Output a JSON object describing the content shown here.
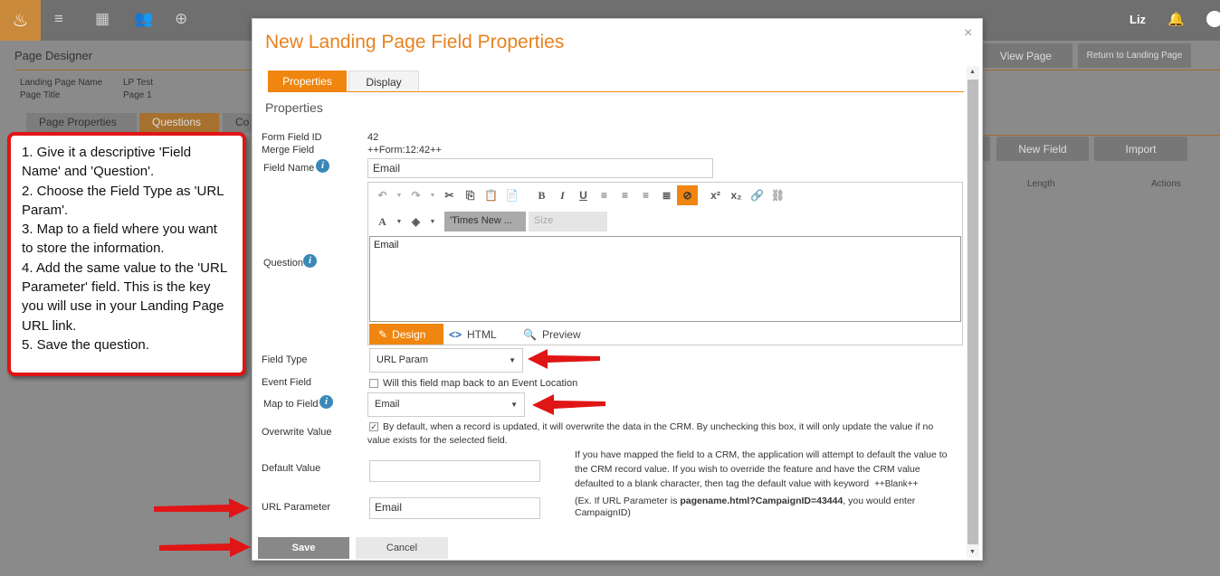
{
  "topbar": {
    "user": "Liz"
  },
  "background": {
    "title": "Page Designer",
    "meta_labels": [
      "Landing Page Name",
      "Page Title"
    ],
    "meta_values": [
      "LP Test",
      "Page 1"
    ],
    "tabs": [
      "Page Properties",
      "Questions",
      "Co"
    ],
    "view_page": "View Page",
    "return_btn": "Return to Landing Page",
    "new_field": "New Field",
    "import": "Import",
    "col_length": "Length",
    "col_actions": "Actions"
  },
  "modal": {
    "title": "New Landing Page Field Properties",
    "close": "×",
    "tabs": [
      "Properties",
      "Display"
    ],
    "section": "Properties",
    "form_field_id_label": "Form Field ID",
    "form_field_id": "42",
    "merge_field_label": "Merge Field",
    "merge_field": "++Form:12:42++",
    "field_name_label": "Field Name",
    "field_name": "Email",
    "question_label": "Question",
    "question_text": "Email",
    "font_name": "'Times New ...",
    "font_size": "Size",
    "modes": [
      "Design",
      "HTML",
      "Preview"
    ],
    "field_type_label": "Field Type",
    "field_type": "URL Param",
    "event_field_label": "Event Field",
    "event_field_text": "Will this field map back to an Event Location",
    "map_to_field_label": "Map to Field",
    "map_to_field": "Email",
    "overwrite_label": "Overwrite Value",
    "overwrite_text": "By default, when a record is updated, it will overwrite the data in the CRM. By unchecking this box, it will only update the value if no value exists for the selected field.",
    "default_value_label": "Default Value",
    "default_value": "",
    "default_help_1": "If you have mapped the field to a CRM, the application will attempt to default the value to the CRM record value.  If you wish to override the feature and have the CRM value defaulted to a blank character, then tag the default value with keyword",
    "default_help_keyword": "++Blank++",
    "url_param_label": "URL Parameter",
    "url_param": "Email",
    "url_help_prefix": "(Ex. If URL Parameter is ",
    "url_help_bold": "pagename.html?CampaignID=43444",
    "url_help_suffix": ", you would enter CampaignID)",
    "save": "Save",
    "cancel": "Cancel"
  },
  "callout": {
    "steps": [
      "1. Give it a descriptive 'Field Name' and 'Question'.",
      "2. Choose the Field Type as 'URL Param'.",
      "3. Map to a field where you want to store the information.",
      "4. Add the same value to the 'URL Parameter' field. This is the key you will use in your Landing Page URL link.",
      "5. Save the question."
    ]
  },
  "colors": {
    "accent": "#f0860f",
    "callout_border": "#e01515",
    "arrow": "#e01515"
  }
}
